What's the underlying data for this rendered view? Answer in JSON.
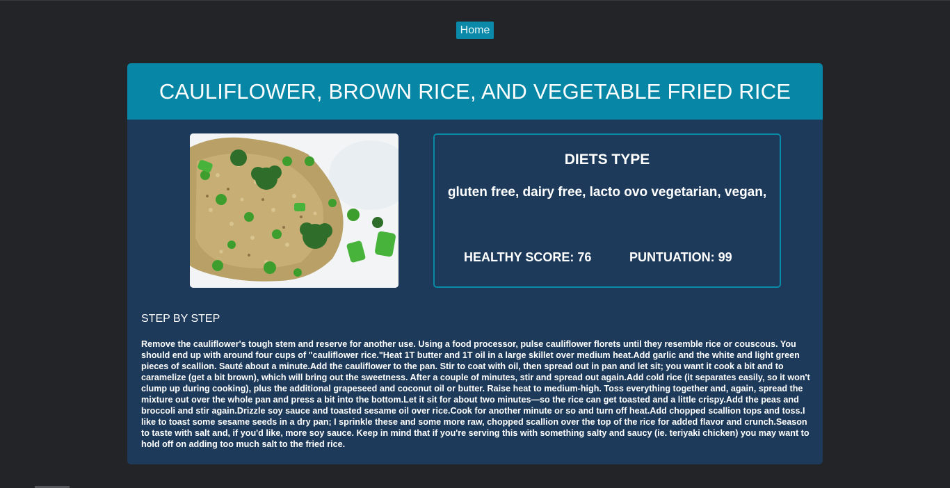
{
  "nav": {
    "home_label": "Home"
  },
  "recipe": {
    "title": "CAULIFLOWER, BROWN RICE, AND VEGETABLE FRIED RICE",
    "diets_heading": "DIETS TYPE",
    "diets": "gluten free, dairy free, lacto ovo vegetarian, vegan,",
    "healthy_score": "HEALTHY SCORE: 76",
    "puntuation": "PUNTUATION: 99",
    "steps_heading": "STEP BY STEP",
    "steps_text": "Remove the cauliflower's tough stem and reserve for another use. Using a food processor, pulse cauliflower florets until they resemble rice or couscous. You should end up with around four cups of \"cauliflower rice.\"Heat 1T butter and 1T oil in a large skillet over medium heat.Add garlic and the white and light green pieces of scallion. Sauté about a minute.Add the cauliflower to the pan. Stir to coat with oil, then spread out in pan and let sit; you want it cook a bit and to caramelize (get a bit brown), which will bring out the sweetness. After a couple of minutes, stir and spread out again.Add cold rice (it separates easily, so it won't clump up during cooking), plus the additional grapeseed and coconut oil or butter. Raise heat to medium-high. Toss everything together and, again, spread the mixture out over the whole pan and press a bit into the bottom.Let it sit for about two minutes—so the rice can get toasted and a little crispy.Add the peas and broccoli and stir again.Drizzle soy sauce and toasted sesame oil over rice.Cook for another minute or so and turn off heat.Add chopped scallion tops and toss.I like to toast some sesame seeds in a dry pan; I sprinkle these and some more raw, chopped scallion over the top of the rice for added flavor and crunch.Season to taste with salt and, if you'd like, more soy sauce. Keep in mind that if you're serving this with something salty and saucy (ie. teriyaki chicken) you may want to hold off on adding too much salt to the fried rice."
  },
  "colors": {
    "background": "#232428",
    "card": "#1d3a5a",
    "accent": "#0787a5"
  }
}
